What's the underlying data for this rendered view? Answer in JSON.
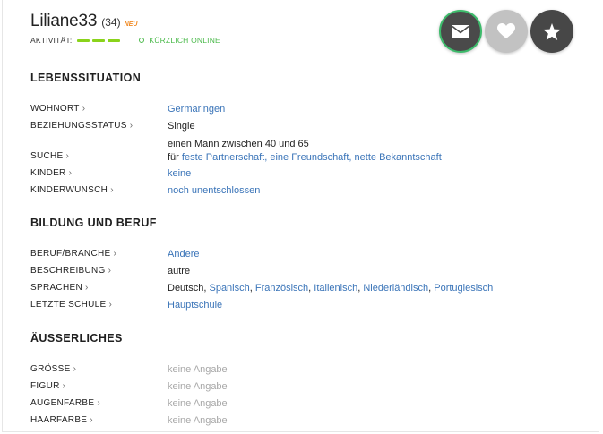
{
  "profile": {
    "username": "Liliane33",
    "age": "(34)",
    "new_badge": "NEU",
    "activity_label": "AKTIVITÄT:",
    "online_status": "KÜRZLICH ONLINE"
  },
  "actions": {
    "message_icon": "envelope-icon",
    "like_icon": "heart-icon",
    "favorite_icon": "star-icon"
  },
  "colors": {
    "link": "#3a74b8",
    "online": "#4cba4c",
    "activity": "#8ad31b",
    "new_badge": "#f08a24"
  },
  "lebenssituation": {
    "title": "LEBENSSITUATION",
    "wohnort_label": "WOHNORT",
    "wohnort_value": "Germaringen",
    "beziehung_label": "BEZIEHUNGSSTATUS",
    "beziehung_value": "Single",
    "suche_label": "SUCHE",
    "suche_line1": "einen Mann zwischen 40 und 65",
    "suche_prefix": "für",
    "suche_opt1": "feste Partnerschaft",
    "suche_opt2": "eine Freundschaft",
    "suche_opt3": "nette Bekanntschaft",
    "kinder_label": "KINDER",
    "kinder_value": "keine",
    "kinderwunsch_label": "KINDERWUNSCH",
    "kinderwunsch_value": "noch unentschlossen"
  },
  "bildung": {
    "title": "BILDUNG UND BERUF",
    "beruf_label": "BERUF/BRANCHE",
    "beruf_value": "Andere",
    "beschreibung_label": "BESCHREIBUNG",
    "beschreibung_value": "autre",
    "sprachen_label": "SPRACHEN",
    "sprachen_first": "Deutsch",
    "sprachen_links": [
      "Spanisch",
      "Französisch",
      "Italienisch",
      "Niederländisch",
      "Portugiesisch"
    ],
    "schule_label": "LETZTE SCHULE",
    "schule_value": "Hauptschule"
  },
  "aeusserliches": {
    "title": "ÄUSSERLICHES",
    "groesse_label": "GRÖSSE",
    "groesse_value": "keine Angabe",
    "figur_label": "FIGUR",
    "figur_value": "keine Angabe",
    "augenfarbe_label": "AUGENFARBE",
    "augenfarbe_value": "keine Angabe",
    "haarfarbe_label": "HAARFARBE",
    "haarfarbe_value": "keine Angabe"
  }
}
